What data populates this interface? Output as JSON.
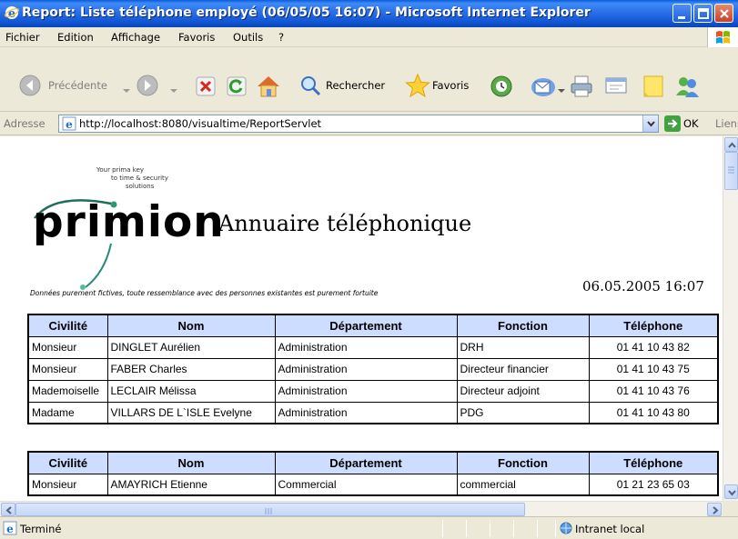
{
  "window": {
    "title": "Report: Liste téléphone employé (06/05/05 16:07) - Microsoft Internet Explorer"
  },
  "menu": [
    "Fichier",
    "Edition",
    "Affichage",
    "Favoris",
    "Outils",
    "?"
  ],
  "toolbar": {
    "back": "Précédente",
    "search": "Rechercher",
    "favorites": "Favoris"
  },
  "address": {
    "label": "Adresse",
    "url": "http://localhost:8080/visualtime/ReportServlet",
    "go": "OK",
    "links": "Liens"
  },
  "report": {
    "logo_tagline": [
      "Your prima key",
      "to time & security",
      "solutions"
    ],
    "brand": "primion",
    "title": "Annuaire téléphonique",
    "date": "06.05.2005 16:07",
    "disclaimer": "Données purement fictives, toute ressemblance avec des personnes existantes est purement fortuite",
    "columns": [
      "Civilité",
      "Nom",
      "Département",
      "Fonction",
      "Téléphone"
    ],
    "group1": [
      [
        "Monsieur",
        "DINGLET Aurélien",
        "Administration",
        "DRH",
        "01 41 10 43 82"
      ],
      [
        "Monsieur",
        "FABER Charles",
        "Administration",
        "Directeur financier",
        "01 41 10 43 75"
      ],
      [
        "Mademoiselle",
        "LECLAIR Mélissa",
        "Administration",
        "Directeur adjoint",
        "01 41 10 43 76"
      ],
      [
        "Madame",
        "VILLARS DE L`ISLE Evelyne",
        "Administration",
        "PDG",
        "01 41 10 43 80"
      ]
    ],
    "group2": [
      [
        "Monsieur",
        "AMAYRICH Etienne",
        "Commercial",
        "commercial",
        "01 21 23 65 03"
      ]
    ]
  },
  "status": {
    "text": "Terminé",
    "zone": "Intranet local"
  },
  "colors": {
    "titlebar": "#0A5BDB",
    "header_fill": "#CCDDFF"
  }
}
